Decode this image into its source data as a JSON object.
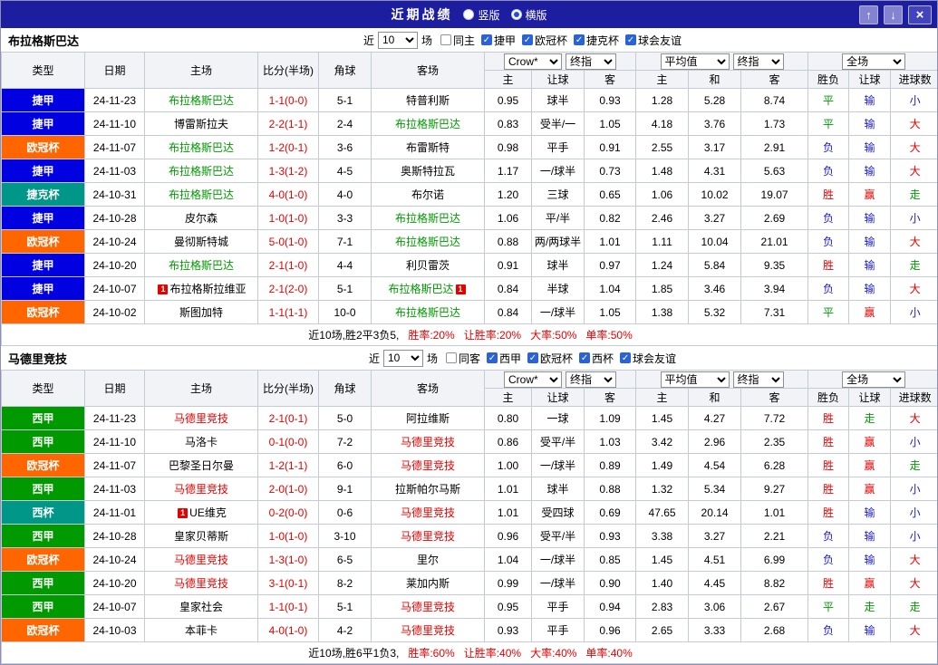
{
  "titlebar": {
    "title": "近期战绩",
    "vertical_label": "竖版",
    "horizontal_label": "横版",
    "selected_layout": "横版"
  },
  "league_colors": {
    "捷甲": "#0000e0",
    "欧冠杯": "#ff6600",
    "捷克杯": "#009688",
    "西甲": "#009900",
    "西杯": "#009688"
  },
  "result_colors": {
    "胜": "#e60000",
    "赢": "#e60000",
    "大": "#e60000",
    "平": "#009900",
    "走": "#009900",
    "负": "#1a1acc",
    "输": "#1a1acc",
    "小": "#1a1acc"
  },
  "sections": [
    {
      "team": "布拉格斯巴达",
      "team_text_color": "#009900",
      "filter": {
        "prefix": "近",
        "count_value": "10",
        "suffix": "场",
        "checkboxes": [
          {
            "label": "同主",
            "checked": false
          },
          {
            "label": "捷甲",
            "checked": true
          },
          {
            "label": "欧冠杯",
            "checked": true
          },
          {
            "label": "捷克杯",
            "checked": true
          },
          {
            "label": "球会友谊",
            "checked": true
          }
        ]
      },
      "header": {
        "base_columns": [
          "类型",
          "日期",
          "主场",
          "比分(半场)",
          "角球",
          "客场"
        ],
        "odds_group1": {
          "select1": "Crow*",
          "select2": "终指",
          "sub": [
            "主",
            "让球",
            "客"
          ]
        },
        "odds_group2": {
          "select1": "平均值",
          "select2": "终指",
          "sub": [
            "主",
            "和",
            "客"
          ]
        },
        "result_group": {
          "select1": "全场",
          "sub": [
            "胜负",
            "让球",
            "进球数"
          ]
        }
      },
      "rows": [
        {
          "league": "捷甲",
          "date": "24-11-23",
          "home": "布拉格斯巴达",
          "home_tracked": true,
          "score": "1-1(0-0)",
          "corner": "5-1",
          "away": "特普利斯",
          "odds": [
            "0.95",
            "球半",
            "0.93"
          ],
          "avg": [
            "1.28",
            "5.28",
            "8.74"
          ],
          "results": [
            "平",
            "输",
            "小"
          ]
        },
        {
          "league": "捷甲",
          "date": "24-11-10",
          "home": "博雷斯拉夫",
          "score": "2-2(1-1)",
          "corner": "2-4",
          "away": "布拉格斯巴达",
          "away_tracked": true,
          "odds": [
            "0.83",
            "受半/一",
            "1.05"
          ],
          "avg": [
            "4.18",
            "3.76",
            "1.73"
          ],
          "results": [
            "平",
            "输",
            "大"
          ]
        },
        {
          "league": "欧冠杯",
          "date": "24-11-07",
          "home": "布拉格斯巴达",
          "home_tracked": true,
          "score": "1-2(0-1)",
          "corner": "3-6",
          "away": "布雷斯特",
          "odds": [
            "0.98",
            "平手",
            "0.91"
          ],
          "avg": [
            "2.55",
            "3.17",
            "2.91"
          ],
          "results": [
            "负",
            "输",
            "大"
          ]
        },
        {
          "league": "捷甲",
          "date": "24-11-03",
          "home": "布拉格斯巴达",
          "home_tracked": true,
          "score": "1-3(1-2)",
          "corner": "4-5",
          "away": "奥斯特拉瓦",
          "odds": [
            "1.17",
            "一/球半",
            "0.73"
          ],
          "avg": [
            "1.48",
            "4.31",
            "5.63"
          ],
          "results": [
            "负",
            "输",
            "大"
          ]
        },
        {
          "league": "捷克杯",
          "date": "24-10-31",
          "home": "布拉格斯巴达",
          "home_tracked": true,
          "score": "4-0(1-0)",
          "corner": "4-0",
          "away": "布尔诺",
          "odds": [
            "1.20",
            "三球",
            "0.65"
          ],
          "avg": [
            "1.06",
            "10.02",
            "19.07"
          ],
          "results": [
            "胜",
            "赢",
            "走"
          ]
        },
        {
          "league": "捷甲",
          "date": "24-10-28",
          "home": "皮尔森",
          "score": "1-0(1-0)",
          "corner": "3-3",
          "away": "布拉格斯巴达",
          "away_tracked": true,
          "odds": [
            "1.06",
            "平/半",
            "0.82"
          ],
          "avg": [
            "2.46",
            "3.27",
            "2.69"
          ],
          "results": [
            "负",
            "输",
            "小"
          ]
        },
        {
          "league": "欧冠杯",
          "date": "24-10-24",
          "home": "曼彻斯特城",
          "score": "5-0(1-0)",
          "corner": "7-1",
          "away": "布拉格斯巴达",
          "away_tracked": true,
          "odds": [
            "0.88",
            "两/两球半",
            "1.01"
          ],
          "avg": [
            "1.11",
            "10.04",
            "21.01"
          ],
          "results": [
            "负",
            "输",
            "大"
          ]
        },
        {
          "league": "捷甲",
          "date": "24-10-20",
          "home": "布拉格斯巴达",
          "home_tracked": true,
          "score": "2-1(1-0)",
          "corner": "4-4",
          "away": "利贝雷茨",
          "odds": [
            "0.91",
            "球半",
            "0.97"
          ],
          "avg": [
            "1.24",
            "5.84",
            "9.35"
          ],
          "results": [
            "胜",
            "输",
            "走"
          ]
        },
        {
          "league": "捷甲",
          "date": "24-10-07",
          "home": "布拉格斯拉维亚",
          "home_badge": "1",
          "score": "2-1(2-0)",
          "corner": "5-1",
          "away": "布拉格斯巴达",
          "away_tracked": true,
          "away_badge": "1",
          "odds": [
            "0.84",
            "半球",
            "1.04"
          ],
          "avg": [
            "1.85",
            "3.46",
            "3.94"
          ],
          "results": [
            "负",
            "输",
            "大"
          ]
        },
        {
          "league": "欧冠杯",
          "date": "24-10-02",
          "home": "斯图加特",
          "score": "1-1(1-1)",
          "corner": "10-0",
          "away": "布拉格斯巴达",
          "away_tracked": true,
          "odds": [
            "0.84",
            "一/球半",
            "1.05"
          ],
          "avg": [
            "1.38",
            "5.32",
            "7.31"
          ],
          "results": [
            "平",
            "赢",
            "小"
          ]
        }
      ],
      "summary": {
        "record": "近10场,胜2平3负5,",
        "rates": [
          "胜率:20%",
          "让胜率:20%",
          "大率:50%",
          "单率:50%"
        ]
      }
    },
    {
      "team": "马德里竞技",
      "team_text_color": "#e60000",
      "filter": {
        "prefix": "近",
        "count_value": "10",
        "suffix": "场",
        "checkboxes": [
          {
            "label": "同客",
            "checked": false
          },
          {
            "label": "西甲",
            "checked": true
          },
          {
            "label": "欧冠杯",
            "checked": true
          },
          {
            "label": "西杯",
            "checked": true
          },
          {
            "label": "球会友谊",
            "checked": true
          }
        ]
      },
      "header": {
        "base_columns": [
          "类型",
          "日期",
          "主场",
          "比分(半场)",
          "角球",
          "客场"
        ],
        "odds_group1": {
          "select1": "Crow*",
          "select2": "终指",
          "sub": [
            "主",
            "让球",
            "客"
          ]
        },
        "odds_group2": {
          "select1": "平均值",
          "select2": "终指",
          "sub": [
            "主",
            "和",
            "客"
          ]
        },
        "result_group": {
          "select1": "全场",
          "sub": [
            "胜负",
            "让球",
            "进球数"
          ]
        }
      },
      "rows": [
        {
          "league": "西甲",
          "date": "24-11-23",
          "home": "马德里竞技",
          "home_tracked": true,
          "score": "2-1(0-1)",
          "corner": "5-0",
          "away": "阿拉维斯",
          "odds": [
            "0.80",
            "一球",
            "1.09"
          ],
          "avg": [
            "1.45",
            "4.27",
            "7.72"
          ],
          "results": [
            "胜",
            "走",
            "大"
          ]
        },
        {
          "league": "西甲",
          "date": "24-11-10",
          "home": "马洛卡",
          "score": "0-1(0-0)",
          "corner": "7-2",
          "away": "马德里竞技",
          "away_tracked": true,
          "odds": [
            "0.86",
            "受平/半",
            "1.03"
          ],
          "avg": [
            "3.42",
            "2.96",
            "2.35"
          ],
          "results": [
            "胜",
            "赢",
            "小"
          ]
        },
        {
          "league": "欧冠杯",
          "date": "24-11-07",
          "home": "巴黎圣日尔曼",
          "score": "1-2(1-1)",
          "corner": "6-0",
          "away": "马德里竞技",
          "away_tracked": true,
          "odds": [
            "1.00",
            "一/球半",
            "0.89"
          ],
          "avg": [
            "1.49",
            "4.54",
            "6.28"
          ],
          "results": [
            "胜",
            "赢",
            "走"
          ]
        },
        {
          "league": "西甲",
          "date": "24-11-03",
          "home": "马德里竞技",
          "home_tracked": true,
          "score": "2-0(1-0)",
          "corner": "9-1",
          "away": "拉斯帕尔马斯",
          "odds": [
            "1.01",
            "球半",
            "0.88"
          ],
          "avg": [
            "1.32",
            "5.34",
            "9.27"
          ],
          "results": [
            "胜",
            "赢",
            "小"
          ]
        },
        {
          "league": "西杯",
          "date": "24-11-01",
          "home": "UE维克",
          "home_badge": "1",
          "score": "0-2(0-0)",
          "corner": "0-6",
          "away": "马德里竞技",
          "away_tracked": true,
          "odds": [
            "1.01",
            "受四球",
            "0.69"
          ],
          "avg": [
            "47.65",
            "20.14",
            "1.01"
          ],
          "results": [
            "胜",
            "输",
            "小"
          ]
        },
        {
          "league": "西甲",
          "date": "24-10-28",
          "home": "皇家贝蒂斯",
          "score": "1-0(1-0)",
          "corner": "3-10",
          "away": "马德里竞技",
          "away_tracked": true,
          "odds": [
            "0.96",
            "受平/半",
            "0.93"
          ],
          "avg": [
            "3.38",
            "3.27",
            "2.21"
          ],
          "results": [
            "负",
            "输",
            "小"
          ]
        },
        {
          "league": "欧冠杯",
          "date": "24-10-24",
          "home": "马德里竞技",
          "home_tracked": true,
          "score": "1-3(1-0)",
          "corner": "6-5",
          "away": "里尔",
          "odds": [
            "1.04",
            "一/球半",
            "0.85"
          ],
          "avg": [
            "1.45",
            "4.51",
            "6.99"
          ],
          "results": [
            "负",
            "输",
            "大"
          ]
        },
        {
          "league": "西甲",
          "date": "24-10-20",
          "home": "马德里竞技",
          "home_tracked": true,
          "score": "3-1(0-1)",
          "corner": "8-2",
          "away": "莱加内斯",
          "odds": [
            "0.99",
            "一/球半",
            "0.90"
          ],
          "avg": [
            "1.40",
            "4.45",
            "8.82"
          ],
          "results": [
            "胜",
            "赢",
            "大"
          ]
        },
        {
          "league": "西甲",
          "date": "24-10-07",
          "home": "皇家社会",
          "score": "1-1(0-1)",
          "corner": "5-1",
          "away": "马德里竞技",
          "away_tracked": true,
          "odds": [
            "0.95",
            "平手",
            "0.94"
          ],
          "avg": [
            "2.83",
            "3.06",
            "2.67"
          ],
          "results": [
            "平",
            "走",
            "走"
          ]
        },
        {
          "league": "欧冠杯",
          "date": "24-10-03",
          "home": "本菲卡",
          "score": "4-0(1-0)",
          "corner": "4-2",
          "away": "马德里竞技",
          "away_tracked": true,
          "odds": [
            "0.93",
            "平手",
            "0.96"
          ],
          "avg": [
            "2.65",
            "3.33",
            "2.68"
          ],
          "results": [
            "负",
            "输",
            "大"
          ]
        }
      ],
      "summary": {
        "record": "近10场,胜6平1负3,",
        "rates": [
          "胜率:60%",
          "让胜率:40%",
          "大率:40%",
          "单率:40%"
        ]
      }
    }
  ]
}
